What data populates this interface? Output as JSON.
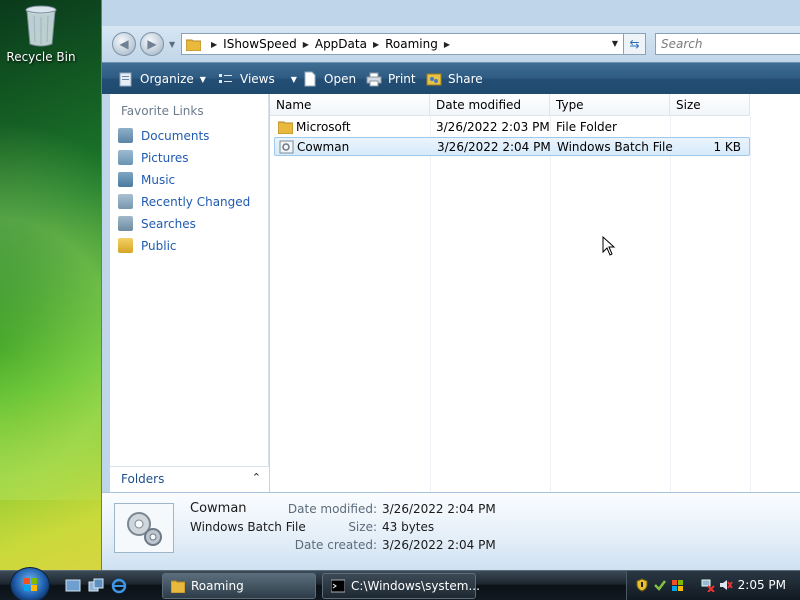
{
  "desktop": {
    "recycle_bin_label": "Recycle Bin"
  },
  "address_bar": {
    "crumbs": [
      "IShowSpeed",
      "AppData",
      "Roaming"
    ],
    "search_placeholder": "Search"
  },
  "toolbar": {
    "organize": "Organize",
    "views": "Views",
    "open": "Open",
    "print": "Print",
    "share": "Share"
  },
  "nav_pane": {
    "title": "Favorite Links",
    "items": [
      "Documents",
      "Pictures",
      "Music",
      "Recently Changed",
      "Searches",
      "Public"
    ],
    "folders_label": "Folders"
  },
  "file_list": {
    "columns": [
      "Name",
      "Date modified",
      "Type",
      "Size"
    ],
    "rows": [
      {
        "name": "Microsoft",
        "date": "3/26/2022 2:03 PM",
        "type": "File Folder",
        "size": ""
      },
      {
        "name": "Cowman",
        "date": "3/26/2022 2:04 PM",
        "type": "Windows Batch File",
        "size": "1 KB"
      }
    ]
  },
  "details": {
    "name": "Cowman",
    "type": "Windows Batch File",
    "date_modified_label": "Date modified:",
    "date_modified": "3/26/2022 2:04 PM",
    "size_label": "Size:",
    "size": "43 bytes",
    "date_created_label": "Date created:",
    "date_created": "3/26/2022 2:04 PM"
  },
  "taskbar": {
    "buttons": [
      "Roaming",
      "C:\\Windows\\system..."
    ],
    "clock": "2:05 PM"
  },
  "colors": {
    "accent": "#1f5bb0",
    "toolbar": "#2c5a82",
    "selection": "#d6eafa"
  }
}
